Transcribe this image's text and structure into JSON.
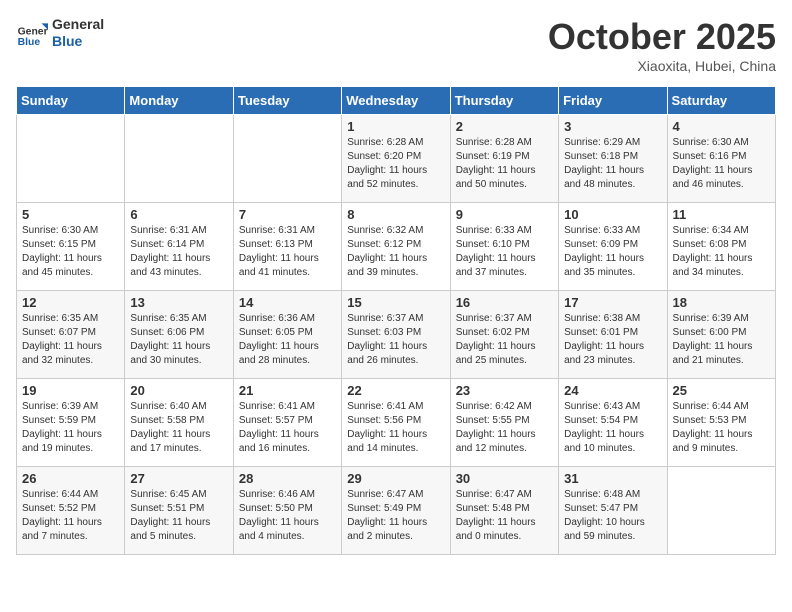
{
  "header": {
    "logo_general": "General",
    "logo_blue": "Blue",
    "month_title": "October 2025",
    "subtitle": "Xiaoxita, Hubei, China"
  },
  "days_of_week": [
    "Sunday",
    "Monday",
    "Tuesday",
    "Wednesday",
    "Thursday",
    "Friday",
    "Saturday"
  ],
  "weeks": [
    [
      {
        "day": "",
        "text": ""
      },
      {
        "day": "",
        "text": ""
      },
      {
        "day": "",
        "text": ""
      },
      {
        "day": "1",
        "text": "Sunrise: 6:28 AM\nSunset: 6:20 PM\nDaylight: 11 hours\nand 52 minutes."
      },
      {
        "day": "2",
        "text": "Sunrise: 6:28 AM\nSunset: 6:19 PM\nDaylight: 11 hours\nand 50 minutes."
      },
      {
        "day": "3",
        "text": "Sunrise: 6:29 AM\nSunset: 6:18 PM\nDaylight: 11 hours\nand 48 minutes."
      },
      {
        "day": "4",
        "text": "Sunrise: 6:30 AM\nSunset: 6:16 PM\nDaylight: 11 hours\nand 46 minutes."
      }
    ],
    [
      {
        "day": "5",
        "text": "Sunrise: 6:30 AM\nSunset: 6:15 PM\nDaylight: 11 hours\nand 45 minutes."
      },
      {
        "day": "6",
        "text": "Sunrise: 6:31 AM\nSunset: 6:14 PM\nDaylight: 11 hours\nand 43 minutes."
      },
      {
        "day": "7",
        "text": "Sunrise: 6:31 AM\nSunset: 6:13 PM\nDaylight: 11 hours\nand 41 minutes."
      },
      {
        "day": "8",
        "text": "Sunrise: 6:32 AM\nSunset: 6:12 PM\nDaylight: 11 hours\nand 39 minutes."
      },
      {
        "day": "9",
        "text": "Sunrise: 6:33 AM\nSunset: 6:10 PM\nDaylight: 11 hours\nand 37 minutes."
      },
      {
        "day": "10",
        "text": "Sunrise: 6:33 AM\nSunset: 6:09 PM\nDaylight: 11 hours\nand 35 minutes."
      },
      {
        "day": "11",
        "text": "Sunrise: 6:34 AM\nSunset: 6:08 PM\nDaylight: 11 hours\nand 34 minutes."
      }
    ],
    [
      {
        "day": "12",
        "text": "Sunrise: 6:35 AM\nSunset: 6:07 PM\nDaylight: 11 hours\nand 32 minutes."
      },
      {
        "day": "13",
        "text": "Sunrise: 6:35 AM\nSunset: 6:06 PM\nDaylight: 11 hours\nand 30 minutes."
      },
      {
        "day": "14",
        "text": "Sunrise: 6:36 AM\nSunset: 6:05 PM\nDaylight: 11 hours\nand 28 minutes."
      },
      {
        "day": "15",
        "text": "Sunrise: 6:37 AM\nSunset: 6:03 PM\nDaylight: 11 hours\nand 26 minutes."
      },
      {
        "day": "16",
        "text": "Sunrise: 6:37 AM\nSunset: 6:02 PM\nDaylight: 11 hours\nand 25 minutes."
      },
      {
        "day": "17",
        "text": "Sunrise: 6:38 AM\nSunset: 6:01 PM\nDaylight: 11 hours\nand 23 minutes."
      },
      {
        "day": "18",
        "text": "Sunrise: 6:39 AM\nSunset: 6:00 PM\nDaylight: 11 hours\nand 21 minutes."
      }
    ],
    [
      {
        "day": "19",
        "text": "Sunrise: 6:39 AM\nSunset: 5:59 PM\nDaylight: 11 hours\nand 19 minutes."
      },
      {
        "day": "20",
        "text": "Sunrise: 6:40 AM\nSunset: 5:58 PM\nDaylight: 11 hours\nand 17 minutes."
      },
      {
        "day": "21",
        "text": "Sunrise: 6:41 AM\nSunset: 5:57 PM\nDaylight: 11 hours\nand 16 minutes."
      },
      {
        "day": "22",
        "text": "Sunrise: 6:41 AM\nSunset: 5:56 PM\nDaylight: 11 hours\nand 14 minutes."
      },
      {
        "day": "23",
        "text": "Sunrise: 6:42 AM\nSunset: 5:55 PM\nDaylight: 11 hours\nand 12 minutes."
      },
      {
        "day": "24",
        "text": "Sunrise: 6:43 AM\nSunset: 5:54 PM\nDaylight: 11 hours\nand 10 minutes."
      },
      {
        "day": "25",
        "text": "Sunrise: 6:44 AM\nSunset: 5:53 PM\nDaylight: 11 hours\nand 9 minutes."
      }
    ],
    [
      {
        "day": "26",
        "text": "Sunrise: 6:44 AM\nSunset: 5:52 PM\nDaylight: 11 hours\nand 7 minutes."
      },
      {
        "day": "27",
        "text": "Sunrise: 6:45 AM\nSunset: 5:51 PM\nDaylight: 11 hours\nand 5 minutes."
      },
      {
        "day": "28",
        "text": "Sunrise: 6:46 AM\nSunset: 5:50 PM\nDaylight: 11 hours\nand 4 minutes."
      },
      {
        "day": "29",
        "text": "Sunrise: 6:47 AM\nSunset: 5:49 PM\nDaylight: 11 hours\nand 2 minutes."
      },
      {
        "day": "30",
        "text": "Sunrise: 6:47 AM\nSunset: 5:48 PM\nDaylight: 11 hours\nand 0 minutes."
      },
      {
        "day": "31",
        "text": "Sunrise: 6:48 AM\nSunset: 5:47 PM\nDaylight: 10 hours\nand 59 minutes."
      },
      {
        "day": "",
        "text": ""
      }
    ]
  ]
}
